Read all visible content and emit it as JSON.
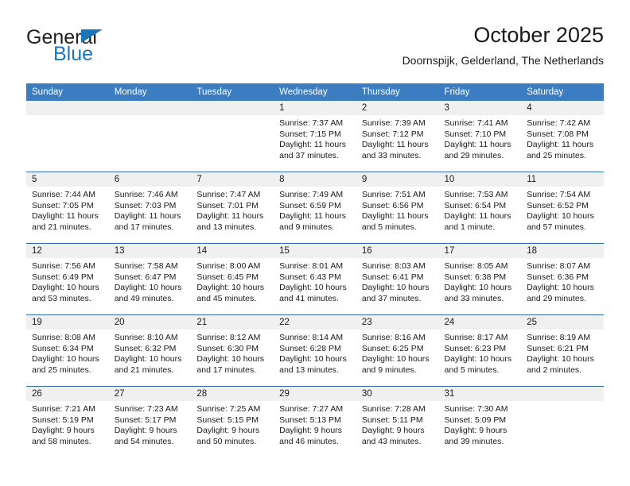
{
  "brand": {
    "name_top": "General",
    "name_bottom": "Blue",
    "triangle_icon": "blue-triangle-icon",
    "colors": {
      "text": "#231f20",
      "accent": "#1b75bb"
    }
  },
  "header": {
    "title": "October 2025",
    "subtitle": "Doornspijk, Gelderland, The Netherlands"
  },
  "theme": {
    "header_bg": "#3b7dc0",
    "row_divider": "#2f6eb5",
    "daynum_bg": "#f0f0f0",
    "cell_bg": "#ffffff"
  },
  "weekday_headers": [
    "Sunday",
    "Monday",
    "Tuesday",
    "Wednesday",
    "Thursday",
    "Friday",
    "Saturday"
  ],
  "weeks": [
    [
      {
        "day": "",
        "sunrise": "",
        "sunset": "",
        "daylight_1": "",
        "daylight_2": "",
        "empty": true
      },
      {
        "day": "",
        "sunrise": "",
        "sunset": "",
        "daylight_1": "",
        "daylight_2": "",
        "empty": true
      },
      {
        "day": "",
        "sunrise": "",
        "sunset": "",
        "daylight_1": "",
        "daylight_2": "",
        "empty": true
      },
      {
        "day": "1",
        "sunrise": "Sunrise: 7:37 AM",
        "sunset": "Sunset: 7:15 PM",
        "daylight_1": "Daylight: 11 hours",
        "daylight_2": "and 37 minutes."
      },
      {
        "day": "2",
        "sunrise": "Sunrise: 7:39 AM",
        "sunset": "Sunset: 7:12 PM",
        "daylight_1": "Daylight: 11 hours",
        "daylight_2": "and 33 minutes."
      },
      {
        "day": "3",
        "sunrise": "Sunrise: 7:41 AM",
        "sunset": "Sunset: 7:10 PM",
        "daylight_1": "Daylight: 11 hours",
        "daylight_2": "and 29 minutes."
      },
      {
        "day": "4",
        "sunrise": "Sunrise: 7:42 AM",
        "sunset": "Sunset: 7:08 PM",
        "daylight_1": "Daylight: 11 hours",
        "daylight_2": "and 25 minutes."
      }
    ],
    [
      {
        "day": "5",
        "sunrise": "Sunrise: 7:44 AM",
        "sunset": "Sunset: 7:05 PM",
        "daylight_1": "Daylight: 11 hours",
        "daylight_2": "and 21 minutes."
      },
      {
        "day": "6",
        "sunrise": "Sunrise: 7:46 AM",
        "sunset": "Sunset: 7:03 PM",
        "daylight_1": "Daylight: 11 hours",
        "daylight_2": "and 17 minutes."
      },
      {
        "day": "7",
        "sunrise": "Sunrise: 7:47 AM",
        "sunset": "Sunset: 7:01 PM",
        "daylight_1": "Daylight: 11 hours",
        "daylight_2": "and 13 minutes."
      },
      {
        "day": "8",
        "sunrise": "Sunrise: 7:49 AM",
        "sunset": "Sunset: 6:59 PM",
        "daylight_1": "Daylight: 11 hours",
        "daylight_2": "and 9 minutes."
      },
      {
        "day": "9",
        "sunrise": "Sunrise: 7:51 AM",
        "sunset": "Sunset: 6:56 PM",
        "daylight_1": "Daylight: 11 hours",
        "daylight_2": "and 5 minutes."
      },
      {
        "day": "10",
        "sunrise": "Sunrise: 7:53 AM",
        "sunset": "Sunset: 6:54 PM",
        "daylight_1": "Daylight: 11 hours",
        "daylight_2": "and 1 minute."
      },
      {
        "day": "11",
        "sunrise": "Sunrise: 7:54 AM",
        "sunset": "Sunset: 6:52 PM",
        "daylight_1": "Daylight: 10 hours",
        "daylight_2": "and 57 minutes."
      }
    ],
    [
      {
        "day": "12",
        "sunrise": "Sunrise: 7:56 AM",
        "sunset": "Sunset: 6:49 PM",
        "daylight_1": "Daylight: 10 hours",
        "daylight_2": "and 53 minutes."
      },
      {
        "day": "13",
        "sunrise": "Sunrise: 7:58 AM",
        "sunset": "Sunset: 6:47 PM",
        "daylight_1": "Daylight: 10 hours",
        "daylight_2": "and 49 minutes."
      },
      {
        "day": "14",
        "sunrise": "Sunrise: 8:00 AM",
        "sunset": "Sunset: 6:45 PM",
        "daylight_1": "Daylight: 10 hours",
        "daylight_2": "and 45 minutes."
      },
      {
        "day": "15",
        "sunrise": "Sunrise: 8:01 AM",
        "sunset": "Sunset: 6:43 PM",
        "daylight_1": "Daylight: 10 hours",
        "daylight_2": "and 41 minutes."
      },
      {
        "day": "16",
        "sunrise": "Sunrise: 8:03 AM",
        "sunset": "Sunset: 6:41 PM",
        "daylight_1": "Daylight: 10 hours",
        "daylight_2": "and 37 minutes."
      },
      {
        "day": "17",
        "sunrise": "Sunrise: 8:05 AM",
        "sunset": "Sunset: 6:38 PM",
        "daylight_1": "Daylight: 10 hours",
        "daylight_2": "and 33 minutes."
      },
      {
        "day": "18",
        "sunrise": "Sunrise: 8:07 AM",
        "sunset": "Sunset: 6:36 PM",
        "daylight_1": "Daylight: 10 hours",
        "daylight_2": "and 29 minutes."
      }
    ],
    [
      {
        "day": "19",
        "sunrise": "Sunrise: 8:08 AM",
        "sunset": "Sunset: 6:34 PM",
        "daylight_1": "Daylight: 10 hours",
        "daylight_2": "and 25 minutes."
      },
      {
        "day": "20",
        "sunrise": "Sunrise: 8:10 AM",
        "sunset": "Sunset: 6:32 PM",
        "daylight_1": "Daylight: 10 hours",
        "daylight_2": "and 21 minutes."
      },
      {
        "day": "21",
        "sunrise": "Sunrise: 8:12 AM",
        "sunset": "Sunset: 6:30 PM",
        "daylight_1": "Daylight: 10 hours",
        "daylight_2": "and 17 minutes."
      },
      {
        "day": "22",
        "sunrise": "Sunrise: 8:14 AM",
        "sunset": "Sunset: 6:28 PM",
        "daylight_1": "Daylight: 10 hours",
        "daylight_2": "and 13 minutes."
      },
      {
        "day": "23",
        "sunrise": "Sunrise: 8:16 AM",
        "sunset": "Sunset: 6:25 PM",
        "daylight_1": "Daylight: 10 hours",
        "daylight_2": "and 9 minutes."
      },
      {
        "day": "24",
        "sunrise": "Sunrise: 8:17 AM",
        "sunset": "Sunset: 6:23 PM",
        "daylight_1": "Daylight: 10 hours",
        "daylight_2": "and 5 minutes."
      },
      {
        "day": "25",
        "sunrise": "Sunrise: 8:19 AM",
        "sunset": "Sunset: 6:21 PM",
        "daylight_1": "Daylight: 10 hours",
        "daylight_2": "and 2 minutes."
      }
    ],
    [
      {
        "day": "26",
        "sunrise": "Sunrise: 7:21 AM",
        "sunset": "Sunset: 5:19 PM",
        "daylight_1": "Daylight: 9 hours",
        "daylight_2": "and 58 minutes."
      },
      {
        "day": "27",
        "sunrise": "Sunrise: 7:23 AM",
        "sunset": "Sunset: 5:17 PM",
        "daylight_1": "Daylight: 9 hours",
        "daylight_2": "and 54 minutes."
      },
      {
        "day": "28",
        "sunrise": "Sunrise: 7:25 AM",
        "sunset": "Sunset: 5:15 PM",
        "daylight_1": "Daylight: 9 hours",
        "daylight_2": "and 50 minutes."
      },
      {
        "day": "29",
        "sunrise": "Sunrise: 7:27 AM",
        "sunset": "Sunset: 5:13 PM",
        "daylight_1": "Daylight: 9 hours",
        "daylight_2": "and 46 minutes."
      },
      {
        "day": "30",
        "sunrise": "Sunrise: 7:28 AM",
        "sunset": "Sunset: 5:11 PM",
        "daylight_1": "Daylight: 9 hours",
        "daylight_2": "and 43 minutes."
      },
      {
        "day": "31",
        "sunrise": "Sunrise: 7:30 AM",
        "sunset": "Sunset: 5:09 PM",
        "daylight_1": "Daylight: 9 hours",
        "daylight_2": "and 39 minutes."
      },
      {
        "day": "",
        "sunrise": "",
        "sunset": "",
        "daylight_1": "",
        "daylight_2": "",
        "empty": true
      }
    ]
  ]
}
